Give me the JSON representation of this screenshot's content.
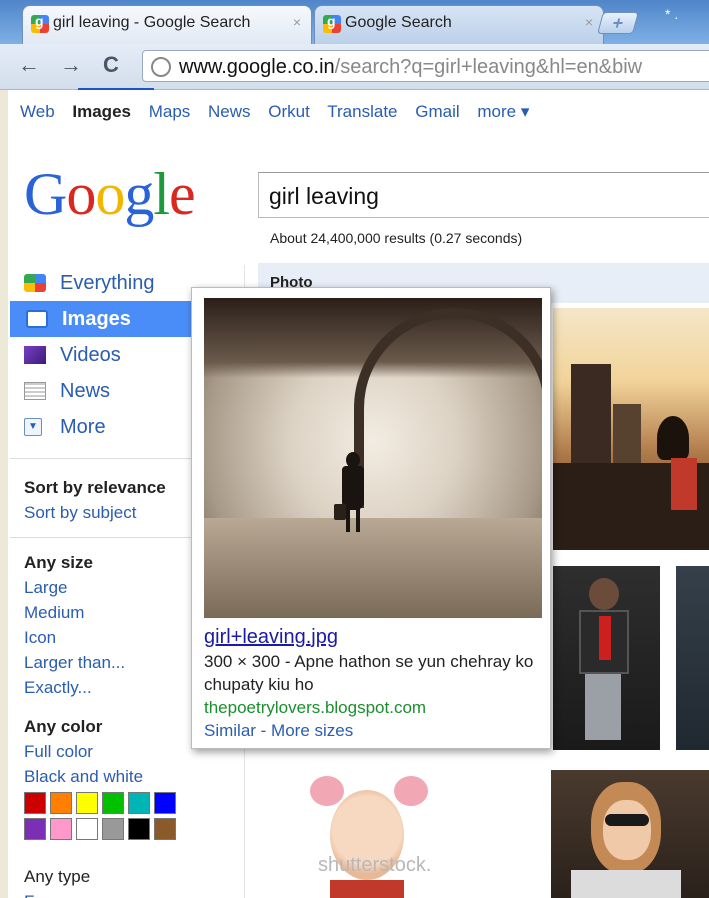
{
  "tabs": [
    {
      "title": "girl leaving - Google Search",
      "close": "×"
    },
    {
      "title": "Google Search",
      "close": "×"
    }
  ],
  "newtab_label": "+",
  "system_icons": "* .",
  "toolbar": {
    "back": "←",
    "forward": "→",
    "reload": "C",
    "url_domain": "www.google.co.in",
    "url_path": "/search?q=girl+leaving&hl=en&biw"
  },
  "gbar": {
    "items": [
      "Web",
      "Images",
      "Maps",
      "News",
      "Orkut",
      "Translate",
      "Gmail"
    ],
    "active": "Images",
    "more": "more ▾"
  },
  "search": {
    "logo": [
      "G",
      "o",
      "o",
      "g",
      "l",
      "e"
    ],
    "query": "girl leaving",
    "stats": "About 24,400,000 results (0.27 seconds)"
  },
  "leftnav": {
    "items": [
      {
        "label": "Everything",
        "icon": "everything-icon"
      },
      {
        "label": "Images",
        "icon": "images-icon",
        "selected": true
      },
      {
        "label": "Videos",
        "icon": "videos-icon"
      },
      {
        "label": "News",
        "icon": "news-icon"
      },
      {
        "label": "More",
        "icon": "dropdown-icon"
      }
    ],
    "sort": {
      "current": "Sort by relevance",
      "alt": "Sort by subject"
    },
    "size": {
      "heading": "Any size",
      "options": [
        "Large",
        "Medium",
        "Icon",
        "Larger than...",
        "Exactly..."
      ]
    },
    "color": {
      "heading": "Any color",
      "options": [
        "Full color",
        "Black and white"
      ],
      "swatches": [
        "#cc0000",
        "#ff8000",
        "#ffff00",
        "#00c000",
        "#00b5b5",
        "#0000ff",
        "#7b2fb4",
        "#ff99cc",
        "#ffffff",
        "#999999",
        "#000000",
        "#8b5a2b"
      ]
    },
    "type": {
      "heading": "Any type",
      "options": [
        "Face"
      ]
    }
  },
  "results": {
    "section_label": "Photo",
    "watermark": "shutterstock."
  },
  "popup": {
    "filename": "girl+leaving.jpg",
    "meta": "300 × 300 - Apne hathon se yun chehray ko chupaty kiu ho",
    "source": "thepoetrylovers.blogspot.com",
    "links": "Similar - More sizes"
  }
}
